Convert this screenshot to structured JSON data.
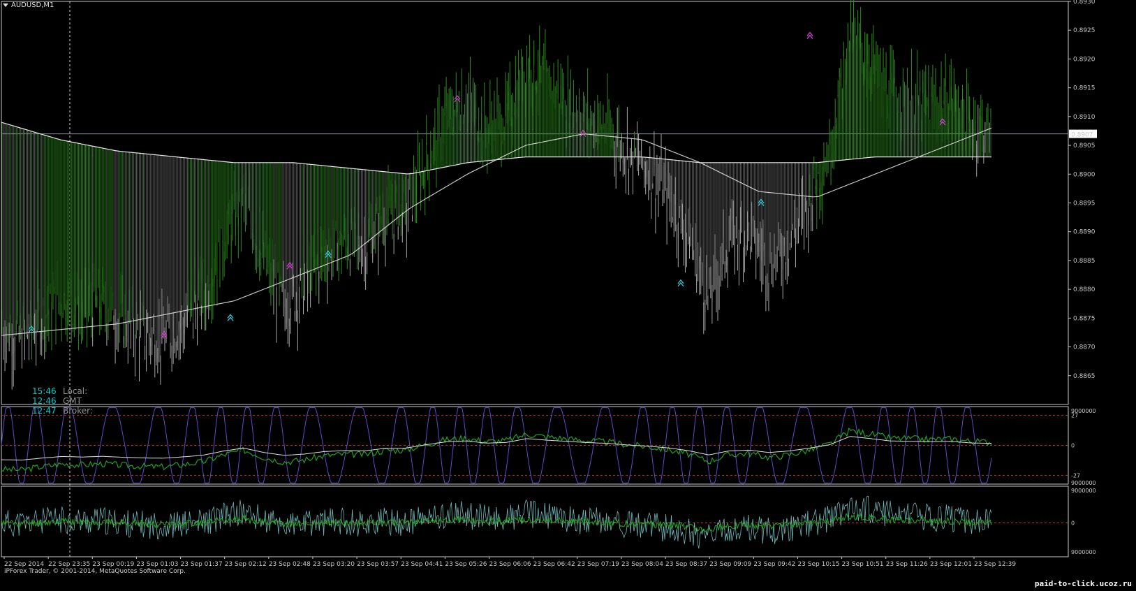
{
  "window": {
    "symbol_timeframe": "AUDUSD,M1"
  },
  "clock": [
    {
      "time": "15:46",
      "name": "Local:"
    },
    {
      "time": "12:46",
      "name": "GMT"
    },
    {
      "time": "12:47",
      "name": "Broker:"
    }
  ],
  "copyright": "iPForex Trader, © 2001-2014, MetaQuotes Software Corp.",
  "watermark": "paid-to-click.ucoz.ru",
  "current_price": "0.8907",
  "colors": {
    "bull": "#2e8b1f",
    "bear": "#a8a8a8",
    "ma": "#e8e8e8",
    "grid": "#4a4a4a",
    "axis": "#c8c8c8",
    "osc_purple": "#5a4ec8",
    "osc_cyan": "#70b8b8",
    "zero_line": "#c03030"
  },
  "chart_data": [
    {
      "type": "bar",
      "panel": "price",
      "y_ticks": [
        "0.8930",
        "0.8925",
        "0.8920",
        "0.8915",
        "0.8910",
        "0.8905",
        "0.8900",
        "0.8895",
        "0.8890",
        "0.8885",
        "0.8880",
        "0.8875",
        "0.8870",
        "0.8865"
      ],
      "ylim": [
        0.886,
        0.893
      ],
      "x_ticks": [
        "22 Sep 2014",
        "22 Sep 23:35",
        "23 Sep 00:19",
        "23 Sep 01:03",
        "23 Sep 01:37",
        "23 Sep 02:12",
        "23 Sep 02:48",
        "23 Sep 03:20",
        "23 Sep 03:57",
        "23 Sep 04:41",
        "23 Sep 05:26",
        "23 Sep 06:06",
        "23 Sep 06:42",
        "23 Sep 07:19",
        "23 Sep 08:04",
        "23 Sep 08:37",
        "23 Sep 09:09",
        "23 Sep 09:42",
        "23 Sep 10:15",
        "23 Sep 10:51",
        "23 Sep 11:26",
        "23 Sep 12:01",
        "23 Sep 12:39"
      ],
      "price_path": [
        0.8873,
        0.8871,
        0.8875,
        0.8878,
        0.8876,
        0.8877,
        0.8874,
        0.8872,
        0.8871,
        0.8874,
        0.8878,
        0.8888,
        0.8895,
        0.8884,
        0.8877,
        0.888,
        0.8886,
        0.8888,
        0.8887,
        0.8893,
        0.8893,
        0.8902,
        0.891,
        0.8913,
        0.8908,
        0.891,
        0.892,
        0.8916,
        0.8913,
        0.891,
        0.8908,
        0.8904,
        0.8901,
        0.8896,
        0.8889,
        0.8878,
        0.8888,
        0.889,
        0.8884,
        0.8888,
        0.8895,
        0.8904,
        0.8925,
        0.892,
        0.8914,
        0.8913,
        0.8912,
        0.8913,
        0.8909,
        0.8908
      ],
      "ma_slow": [
        0.8909,
        0.8906,
        0.8904,
        0.8903,
        0.8902,
        0.8902,
        0.8901,
        0.89,
        0.8902,
        0.8903,
        0.8903,
        0.8903,
        0.8902,
        0.8902,
        0.8902,
        0.8903,
        0.8903,
        0.8903
      ],
      "ma_fast": [
        0.8872,
        0.8873,
        0.8874,
        0.8876,
        0.8878,
        0.8882,
        0.8886,
        0.8894,
        0.89,
        0.8905,
        0.8907,
        0.8906,
        0.8902,
        0.8897,
        0.8896,
        0.89,
        0.8904,
        0.8908
      ],
      "y_min_reading": 0.886
    },
    {
      "type": "line",
      "panel": "oscillator_1",
      "y_ticks_right": [
        "9000000",
        "27",
        "0",
        "-27",
        "9000000"
      ],
      "levels": [
        27,
        0,
        -27
      ],
      "ylim": [
        -35,
        35
      ]
    },
    {
      "type": "line",
      "panel": "oscillator_2",
      "y_ticks_right": [
        "9000000",
        "0",
        "9000000"
      ],
      "ylim": [
        -1,
        1
      ]
    }
  ]
}
